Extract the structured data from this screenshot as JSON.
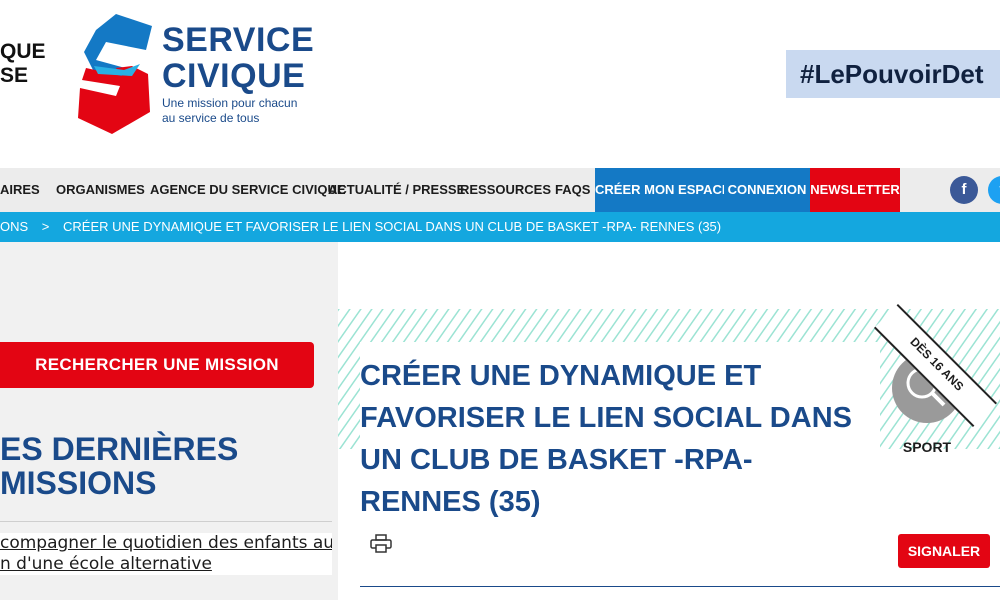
{
  "header": {
    "gov_logo_lines": [
      "QUE",
      "SE"
    ],
    "brand_name_lines": [
      "SERVICE",
      "CIVIQUE"
    ],
    "tagline_lines": [
      "Une mission pour chacun",
      "au service de tous"
    ],
    "hashtag": "#LePouvoirDet"
  },
  "nav": {
    "items": [
      "AIRES",
      "ORGANISMES",
      "AGENCE DU SERVICE CIVIQUE",
      "ACTUALITÉ / PRESSE",
      "RESSOURCES",
      "FAQS"
    ],
    "create_space": "CRÉER MON ESPACE",
    "login": "CONNEXION",
    "newsletter": "NEWSLETTER",
    "social": [
      "facebook-icon",
      "twitter-icon"
    ],
    "colors": {
      "blue": "#1479c5",
      "red": "#e30513",
      "nav_bg": "#ececec"
    }
  },
  "breadcrumb": {
    "prev": "ONS",
    "separator": ">",
    "current": "CRÉER UNE DYNAMIQUE ET FAVORISER LE LIEN SOCIAL DANS UN CLUB DE BASKET -RPA- RENNES (35)"
  },
  "sidebar": {
    "search_button": "RECHERCHER UNE MISSION",
    "latest_title_lines": [
      "ES DERNIÈRES",
      "MISSIONS"
    ],
    "latest_item_lines": [
      "compagner le quotidien des enfants au",
      "n d'une école alternative"
    ]
  },
  "mission": {
    "title_lines": [
      "CRÉER UNE DYNAMIQUE ET",
      "FAVORISER LE LIEN SOCIAL DANS",
      "UN CLUB DE BASKET -RPA-",
      "RENNES (35)"
    ],
    "age_banner": "DÈS 16 ANS",
    "category": "SPORT",
    "category_icon": "ping-pong-icon",
    "report_button": "SIGNALER",
    "print_icon": "printer-icon"
  }
}
